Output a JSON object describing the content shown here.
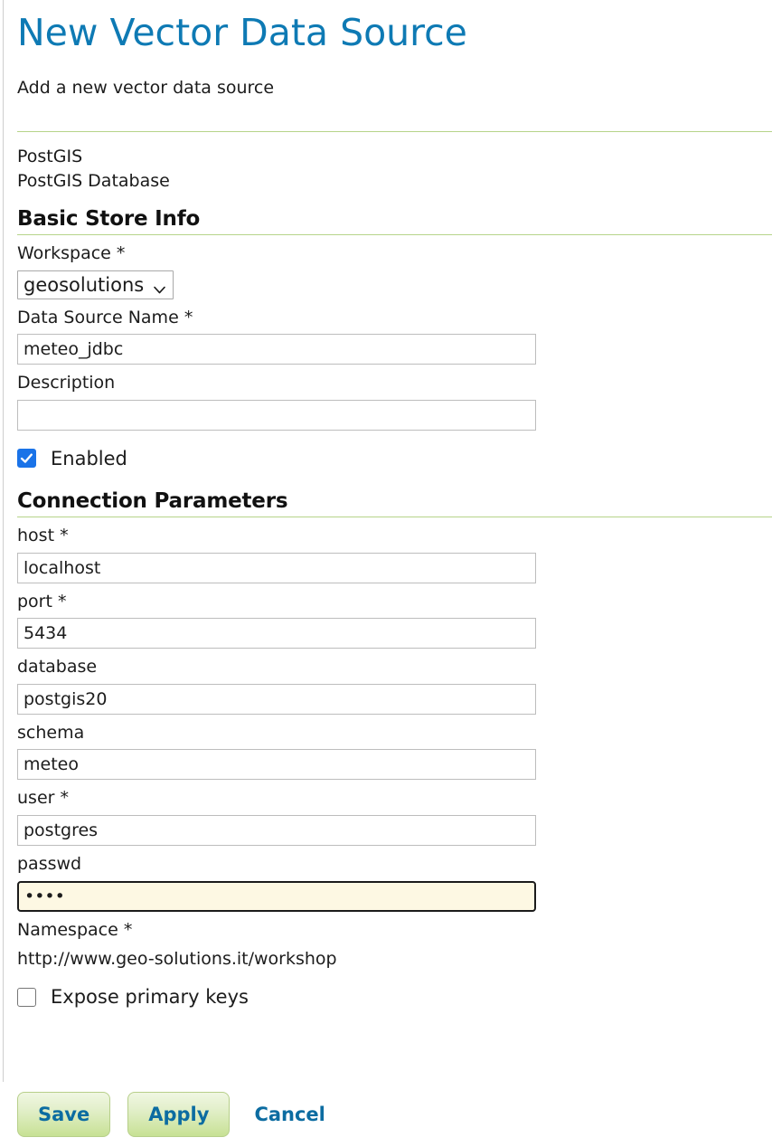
{
  "page": {
    "title": "New Vector Data Source",
    "subtitle": "Add a new vector data source",
    "store_type": "PostGIS",
    "store_type_description": "PostGIS Database"
  },
  "colors": {
    "title_blue": "#0e7ab4",
    "separator_green": "#b6d48a",
    "button_green_top": "#f0f7e2",
    "button_green_bottom": "#c7e194",
    "link_blue": "#0c6ca1",
    "checkbox_blue": "#1a73e8",
    "focus_field_background": "#fdf8e3"
  },
  "basic_store_info": {
    "heading": "Basic Store Info",
    "workspace": {
      "label": "Workspace",
      "required_marker": "*",
      "value": "geosolutions",
      "options": [
        "geosolutions"
      ],
      "caret_icon": "chevron-down-icon"
    },
    "data_source_name": {
      "label": "Data Source Name",
      "required_marker": "*",
      "value": "meteo_jdbc",
      "placeholder": ""
    },
    "description": {
      "label": "Description",
      "required_marker": "",
      "value": "",
      "placeholder": ""
    },
    "enabled": {
      "label": "Enabled",
      "checked": true
    }
  },
  "connection_parameters": {
    "heading": "Connection Parameters",
    "fields": [
      {
        "name": "host",
        "label": "host",
        "required_marker": "*",
        "value": "localhost",
        "placeholder": "",
        "focused": false,
        "type": "text"
      },
      {
        "name": "port",
        "label": "port",
        "required_marker": "*",
        "value": "5434",
        "placeholder": "",
        "focused": false,
        "type": "text"
      },
      {
        "name": "database",
        "label": "database",
        "required_marker": "",
        "value": "postgis20",
        "placeholder": "",
        "focused": false,
        "type": "text"
      },
      {
        "name": "schema",
        "label": "schema",
        "required_marker": "",
        "value": "meteo",
        "placeholder": "",
        "focused": false,
        "type": "text"
      },
      {
        "name": "user",
        "label": "user",
        "required_marker": "*",
        "value": "postgres",
        "placeholder": "",
        "focused": false,
        "type": "text"
      },
      {
        "name": "passwd",
        "label": "passwd",
        "required_marker": "",
        "value": "1234",
        "placeholder": "",
        "focused": true,
        "type": "password"
      }
    ],
    "namespace": {
      "label": "Namespace",
      "required_marker": "*",
      "value": "http://www.geo-solutions.it/workshop"
    },
    "expose_primary_keys": {
      "label": "Expose primary keys",
      "checked": false
    }
  },
  "actions": {
    "save_label": "Save",
    "apply_label": "Apply",
    "cancel_label": "Cancel"
  }
}
